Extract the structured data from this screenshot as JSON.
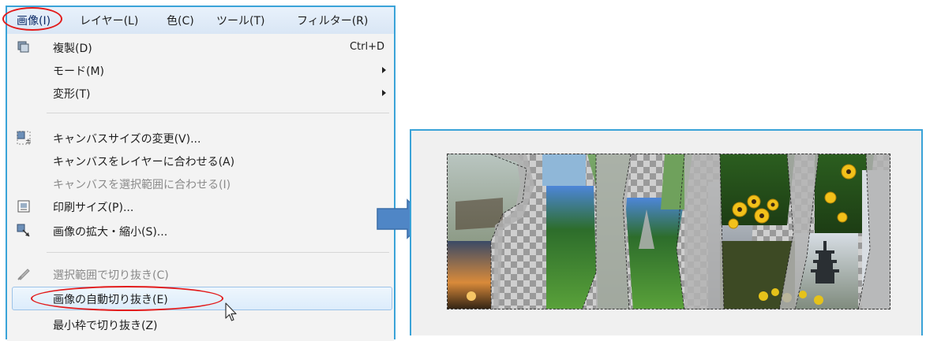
{
  "menubar": {
    "items": [
      {
        "label": "画像(I)",
        "active": true
      },
      {
        "label": "レイヤー(L)"
      },
      {
        "label": "色(C)"
      },
      {
        "label": "ツール(T)"
      },
      {
        "label": "フィルター(R)"
      }
    ]
  },
  "menu": {
    "items": [
      {
        "label": "複製(D)",
        "accel": "Ctrl+D",
        "icon": "duplicate-icon"
      },
      {
        "label": "モード(M)",
        "submenu": true
      },
      {
        "label": "変形(T)",
        "submenu": true
      },
      {
        "label": "キャンバスサイズの変更(V)...",
        "icon": "canvas-size-icon"
      },
      {
        "label": "キャンバスをレイヤーに合わせる(A)"
      },
      {
        "label": "キャンバスを選択範囲に合わせる(I)",
        "disabled": true
      },
      {
        "label": "印刷サイズ(P)...",
        "icon": "print-size-icon"
      },
      {
        "label": "画像の拡大・縮小(S)...",
        "icon": "scale-image-icon"
      },
      {
        "label": "選択範囲で切り抜き(C)",
        "icon": "crop-icon",
        "disabled": true
      },
      {
        "label": "画像の自動切り抜き(E)",
        "hovered": true
      },
      {
        "label": "最小枠で切り抜き(Z)"
      }
    ]
  },
  "colors": {
    "annotation_red": "#e21b1b",
    "frame_blue": "#3aa3d8",
    "arrow_blue": "#4f86c6"
  }
}
